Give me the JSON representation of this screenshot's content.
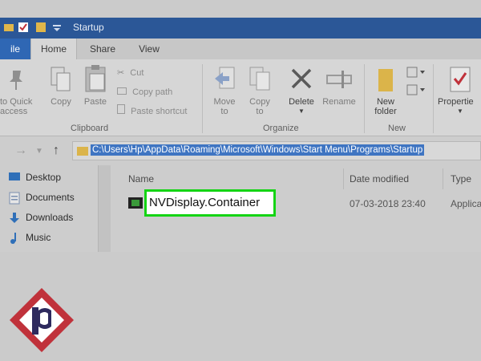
{
  "window": {
    "title": "Startup"
  },
  "tabs": [
    {
      "label": "ile"
    },
    {
      "label": "Home"
    },
    {
      "label": "Share"
    },
    {
      "label": "View"
    }
  ],
  "ribbon": {
    "clipboard": {
      "pin_label_1": "to Quick",
      "pin_label_2": "access",
      "copy": "Copy",
      "paste": "Paste",
      "cut": "Cut",
      "copy_path": "Copy path",
      "paste_shortcut": "Paste shortcut",
      "group": "Clipboard"
    },
    "organize": {
      "move_1": "Move",
      "move_2": "to",
      "copy_1": "Copy",
      "copy_2": "to",
      "delete": "Delete",
      "rename": "Rename",
      "group": "Organize"
    },
    "new": {
      "new_folder_1": "New",
      "new_folder_2": "folder",
      "group": "New"
    },
    "open": {
      "properties": "Propertie"
    }
  },
  "address": {
    "path": "C:\\Users\\Hp\\AppData\\Roaming\\Microsoft\\Windows\\Start Menu\\Programs\\Startup"
  },
  "nav_pane": {
    "items": [
      {
        "label": "Desktop",
        "icon": "desktop-icon"
      },
      {
        "label": "Documents",
        "icon": "documents-icon"
      },
      {
        "label": "Downloads",
        "icon": "downloads-icon"
      },
      {
        "label": "Music",
        "icon": "music-icon"
      }
    ]
  },
  "file_list": {
    "columns": {
      "name": "Name",
      "date": "Date modified",
      "type": "Type"
    },
    "rows": [
      {
        "name": "NVDisplay.Container",
        "date": "07-03-2018 23:40",
        "type": "Applica"
      }
    ]
  },
  "colors": {
    "title_bar": "#2b5797",
    "highlight_box": "#14d414",
    "address_selection": "#3f75c2",
    "logo_red": "#c0323b"
  }
}
